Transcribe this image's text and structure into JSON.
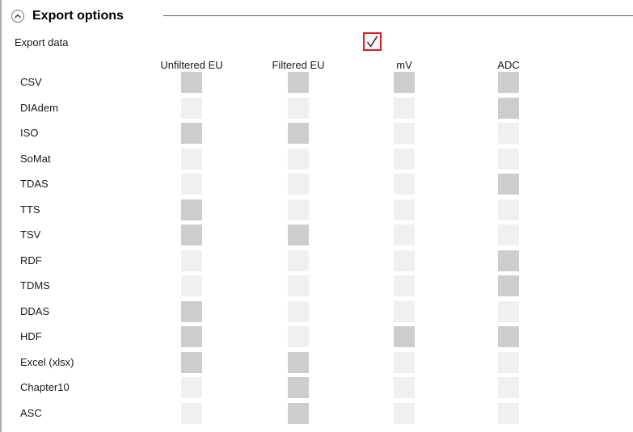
{
  "section": {
    "title": "Export options",
    "collapse_icon": "chevron-up-icon"
  },
  "export_data": {
    "label": "Export data",
    "checked": true,
    "accent_color": "#d61f26"
  },
  "columns": [
    "Unfiltered EU",
    "Filtered EU",
    "mV",
    "ADC"
  ],
  "rows": [
    {
      "label": "CSV",
      "values": [
        true,
        true,
        true,
        true
      ]
    },
    {
      "label": "DIAdem",
      "values": [
        false,
        false,
        false,
        true
      ]
    },
    {
      "label": "ISO",
      "values": [
        true,
        true,
        false,
        false
      ]
    },
    {
      "label": "SoMat",
      "values": [
        false,
        false,
        false,
        false
      ]
    },
    {
      "label": "TDAS",
      "values": [
        false,
        false,
        false,
        true
      ]
    },
    {
      "label": "TTS",
      "values": [
        true,
        false,
        false,
        false
      ]
    },
    {
      "label": "TSV",
      "values": [
        true,
        true,
        false,
        false
      ]
    },
    {
      "label": "RDF",
      "values": [
        false,
        false,
        false,
        true
      ]
    },
    {
      "label": "TDMS",
      "values": [
        false,
        false,
        false,
        true
      ]
    },
    {
      "label": "DDAS",
      "values": [
        true,
        false,
        false,
        false
      ]
    },
    {
      "label": "HDF",
      "values": [
        true,
        false,
        true,
        true
      ]
    },
    {
      "label": "Excel (xlsx)",
      "values": [
        true,
        true,
        false,
        false
      ]
    },
    {
      "label": "Chapter10",
      "values": [
        false,
        true,
        false,
        false
      ]
    },
    {
      "label": "ASC",
      "values": [
        false,
        true,
        false,
        false
      ]
    }
  ]
}
